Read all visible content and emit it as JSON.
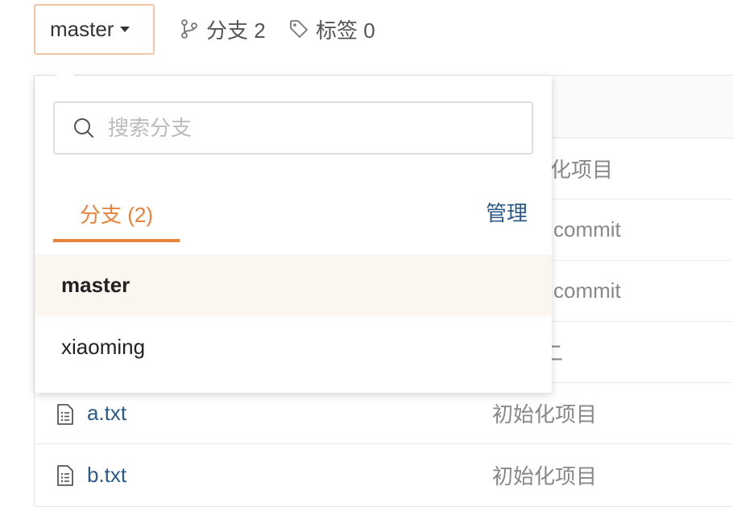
{
  "branch_selector": {
    "current": "master"
  },
  "meta": {
    "branches_label": "分支 2",
    "tags_label": "标签 0"
  },
  "dropdown": {
    "search_placeholder": "搜索分支",
    "tab_label": "分支 (2)",
    "manage_label": "管理",
    "branches": [
      "master",
      "xiaoming"
    ]
  },
  "files": {
    "partial_msgs": [
      "化项目",
      "commit",
      "commit",
      "二"
    ],
    "rows": [
      {
        "name": "a.txt",
        "message": "初始化项目"
      },
      {
        "name": "b.txt",
        "message": "初始化项目"
      }
    ]
  },
  "colors": {
    "accent": "#e8833a",
    "link": "#2b5a8a",
    "selected_bg": "#fcf6f1"
  }
}
